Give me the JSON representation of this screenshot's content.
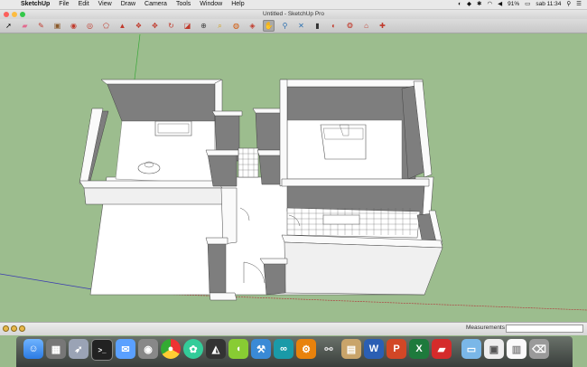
{
  "menubar": {
    "app_name": "SketchUp",
    "menus": [
      "File",
      "Edit",
      "View",
      "Draw",
      "Camera",
      "Tools",
      "Window",
      "Help"
    ],
    "battery": "91%",
    "clock": "sab 11:34"
  },
  "window": {
    "title": "Untitled - SketchUp Pro"
  },
  "toolbar": {
    "tools": [
      "select-icon",
      "eraser-icon",
      "pencil-icon",
      "rectangle-icon",
      "circle-icon",
      "arc-icon",
      "polygon-icon",
      "pushpull-icon",
      "followme-icon",
      "move-icon",
      "rotate-icon",
      "scale-icon",
      "offset-icon",
      "tape-icon",
      "paint-icon",
      "orbit-icon",
      "pan-icon",
      "zoom-icon",
      "zoom-extents-icon",
      "section-icon",
      "materials-icon",
      "components-icon",
      "warehouse-icon",
      "extension-icon"
    ],
    "selected_tool": "orbit-icon"
  },
  "statusbar": {
    "measurements_label": "Measurements"
  },
  "dock": {
    "items": [
      "finder-icon",
      "launchpad-icon",
      "rocket-icon",
      "terminal-icon",
      "messages-icon",
      "camera-icon",
      "chrome-icon",
      "gamecenter-icon",
      "unity-icon",
      "android-icon",
      "xcode-icon",
      "arduino-icon",
      "settings-icon",
      "glasses-icon",
      "notes-icon",
      "word-icon",
      "powerpoint-icon",
      "excel-icon",
      "sketchup-icon",
      "folder-icon",
      "preview-icon",
      "textedit-icon",
      "trash-icon"
    ]
  },
  "colors": {
    "viewport_bg": "#9cbd8e",
    "wall_top": "#ffffff",
    "wall_dark": "#7a7a7a",
    "floor": "#ffffff"
  }
}
